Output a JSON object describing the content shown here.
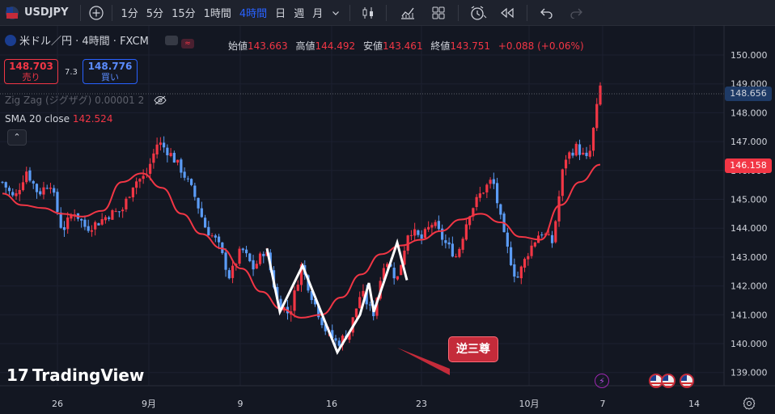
{
  "toolbar": {
    "symbol": "USDJPY",
    "timeframes": [
      "1分",
      "5分",
      "15分",
      "1時間",
      "4時間",
      "日",
      "週",
      "月"
    ],
    "active_timeframe": "4時間"
  },
  "legend": {
    "title": "米ドル／円 · 4時間 · FXCM",
    "open_label": "始値",
    "open": "143.663",
    "high_label": "高値",
    "high": "144.492",
    "low_label": "安値",
    "low": "143.461",
    "close_label": "終値",
    "close": "143.751",
    "change": "+0.088 (+0.06%)"
  },
  "trade": {
    "sell_price": "148.703",
    "sell_label": "売り",
    "spread": "7.3",
    "buy_price": "148.776",
    "buy_label": "買い"
  },
  "indicators": {
    "zigzag": "Zig Zag (ジグザグ) 0.00001 2",
    "sma_name": "SMA 20 close",
    "sma_value": "142.524"
  },
  "price_axis": [
    "150.000",
    "149.000",
    "148.000",
    "147.000",
    "146.000",
    "145.000",
    "144.000",
    "143.000",
    "142.000",
    "141.000",
    "140.000",
    "139.000"
  ],
  "price_tags": {
    "current": "148.656",
    "sma": "146.158"
  },
  "time_axis": [
    "26",
    "9月",
    "9",
    "16",
    "23",
    "10月",
    "7",
    "14"
  ],
  "annotation": "逆三尊",
  "logo": "TradingView",
  "colors": {
    "up": "#f23645",
    "down": "#5b9cf6",
    "sma": "#f23645",
    "zigzag": "#ffffff",
    "background": "#131722"
  },
  "chart_data": {
    "type": "candlestick",
    "ylim": [
      138.6,
      150.5
    ],
    "x_labels": [
      "26",
      "9月",
      "9",
      "16",
      "23",
      "10月",
      "7",
      "14"
    ],
    "close_path": [
      145.6,
      145.0,
      146.0,
      145.2,
      145.6,
      143.9,
      144.6,
      144.0,
      144.2,
      144.5,
      144.6,
      145.6,
      145.8,
      147.0,
      146.6,
      146.0,
      145.2,
      144.0,
      143.5,
      142.3,
      143.3,
      142.6,
      143.3,
      141.5,
      141.0,
      142.7,
      141.5,
      140.5,
      140.0,
      140.4,
      141.8,
      141.0,
      143.0,
      142.2,
      144.0,
      143.6,
      144.2,
      143.5,
      143.0,
      144.5,
      145.2,
      145.7,
      143.6,
      142.2,
      143.2,
      143.9,
      143.5,
      146.4,
      146.8,
      146.3,
      148.9
    ],
    "sma_20": [
      145.2,
      144.8,
      144.7,
      144.5,
      144.4,
      144.6,
      145.6,
      145.9,
      145.4,
      144.5,
      143.8,
      143.3,
      142.6,
      141.8,
      141.2,
      140.9,
      141.0,
      141.6,
      142.4,
      143.1,
      143.4,
      143.6,
      143.9,
      144.3,
      144.5,
      144.2,
      143.7,
      143.6,
      144.8,
      145.6,
      146.2
    ],
    "zigzag": [
      143.3,
      141.1,
      142.7,
      139.7,
      141.0,
      142.1,
      141.1,
      143.5,
      142.2
    ],
    "pattern": "逆三尊"
  }
}
